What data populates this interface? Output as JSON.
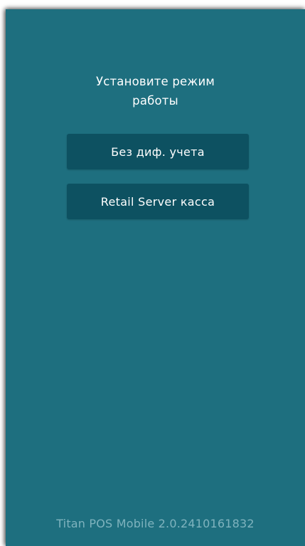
{
  "screen": {
    "background_color": "#1e6f7f",
    "title_line1": "Установите режим",
    "title_line2": "работы"
  },
  "modes": {
    "button_color": "#0d5161",
    "items": [
      {
        "label": "Без диф. учета"
      },
      {
        "label": "Retail Server касса"
      }
    ]
  },
  "footer": {
    "version_text": "Titan POS Mobile 2.0.2410161832",
    "version_color": "#7fb3be"
  }
}
